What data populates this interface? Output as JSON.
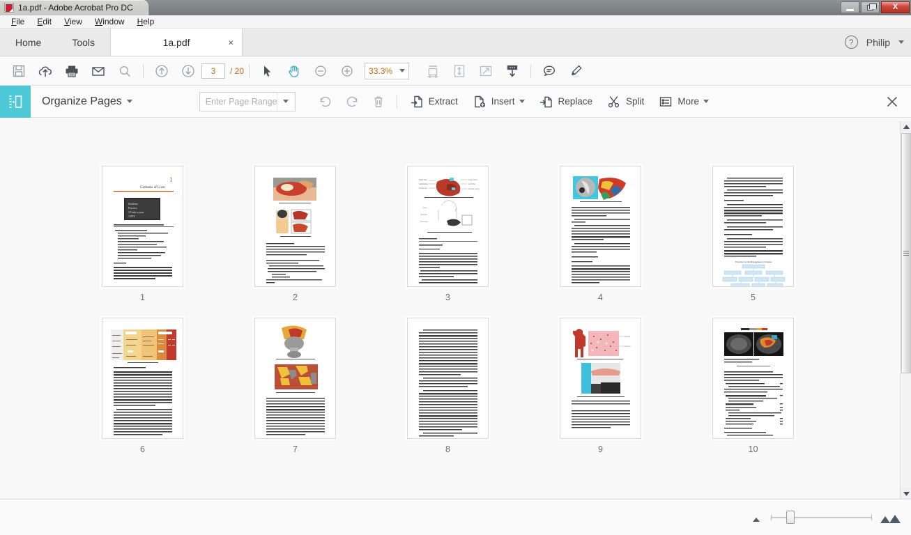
{
  "window": {
    "title": "1a.pdf - Adobe Acrobat Pro DC",
    "app_icon": "acrobat-icon",
    "minimize_label": "Minimize",
    "restore_label": "Restore",
    "close_label": "X"
  },
  "menubar": {
    "items": [
      {
        "label": "File",
        "accel": "F"
      },
      {
        "label": "Edit",
        "accel": "E"
      },
      {
        "label": "View",
        "accel": "V"
      },
      {
        "label": "Window",
        "accel": "W"
      },
      {
        "label": "Help",
        "accel": "H"
      }
    ]
  },
  "tabbar": {
    "home_label": "Home",
    "tools_label": "Tools",
    "document_tab": "1a.pdf",
    "document_tab_close": "×",
    "help_icon": "?",
    "user_name": "Philip"
  },
  "toolbar": {
    "icons": [
      {
        "name": "save-icon",
        "title": "Save"
      },
      {
        "name": "upload-cloud-icon",
        "title": "Save to cloud"
      },
      {
        "name": "print-icon",
        "title": "Print"
      },
      {
        "name": "email-icon",
        "title": "Email"
      },
      {
        "name": "search-icon",
        "title": "Find"
      }
    ],
    "prev_page_icon": "arrow-up-circle-icon",
    "next_page_icon": "arrow-down-circle-icon",
    "page_number": "3",
    "page_total": "/ 20",
    "select_tool_icon": "cursor-arrow-icon",
    "hand_tool_icon": "hand-icon",
    "zoom_out_icon": "zoom-out-icon",
    "zoom_in_icon": "zoom-in-icon",
    "zoom_value": "33.3%",
    "view_icons": [
      {
        "name": "fit-width-icon",
        "title": "Fit width"
      },
      {
        "name": "fit-page-icon",
        "title": "Fit page"
      },
      {
        "name": "fullscreen-icon",
        "title": "Full screen"
      },
      {
        "name": "scroll-down-icon",
        "title": "Scroll down"
      }
    ],
    "comment_icon": "comment-bubble-icon",
    "highlight_icon": "highlighter-pen-icon"
  },
  "organize": {
    "badge_icon": "organize-pages-icon",
    "badge_color": "#4cc8d6",
    "title": "Organize Pages",
    "page_range_placeholder": "Enter Page Range",
    "rotate_ccw_icon": "rotate-counterclockwise-icon",
    "rotate_cw_icon": "rotate-clockwise-icon",
    "delete_icon": "trash-icon",
    "actions": [
      {
        "label": "Extract",
        "icon": "extract-page-icon",
        "has_dropdown": false
      },
      {
        "label": "Insert",
        "icon": "insert-page-icon",
        "has_dropdown": true
      },
      {
        "label": "Replace",
        "icon": "replace-page-icon",
        "has_dropdown": false
      },
      {
        "label": "Split",
        "icon": "scissors-icon",
        "has_dropdown": false
      },
      {
        "label": "More",
        "icon": "list-icon",
        "has_dropdown": true
      }
    ],
    "close_icon": "close-icon"
  },
  "pages": [
    {
      "label": "1",
      "layout": "title-blackboard"
    },
    {
      "label": "2",
      "layout": "two-photos"
    },
    {
      "label": "3",
      "layout": "anatomy-diagrams"
    },
    {
      "label": "4",
      "layout": "scan-and-liver"
    },
    {
      "label": "5",
      "layout": "text-flowchart"
    },
    {
      "label": "6",
      "layout": "color-table"
    },
    {
      "label": "7",
      "layout": "surgery-photos"
    },
    {
      "label": "8",
      "layout": "dense-text"
    },
    {
      "label": "9",
      "layout": "figure-and-clinical"
    },
    {
      "label": "10",
      "layout": "ct-scans"
    }
  ],
  "statusbar": {
    "small_thumb_icon": "small-mountain-icon",
    "large_thumb_icon": "large-mountain-icon",
    "slider_name": "thumbnail-size-slider"
  },
  "scrollbar": {
    "up_icon": "scroll-up-arrow-icon",
    "down_icon": "scroll-down-arrow-icon"
  },
  "colors": {
    "accent_cyan": "#4cc8d6",
    "page_number_orange": "#c06a14",
    "close_red": "#b32f20"
  }
}
